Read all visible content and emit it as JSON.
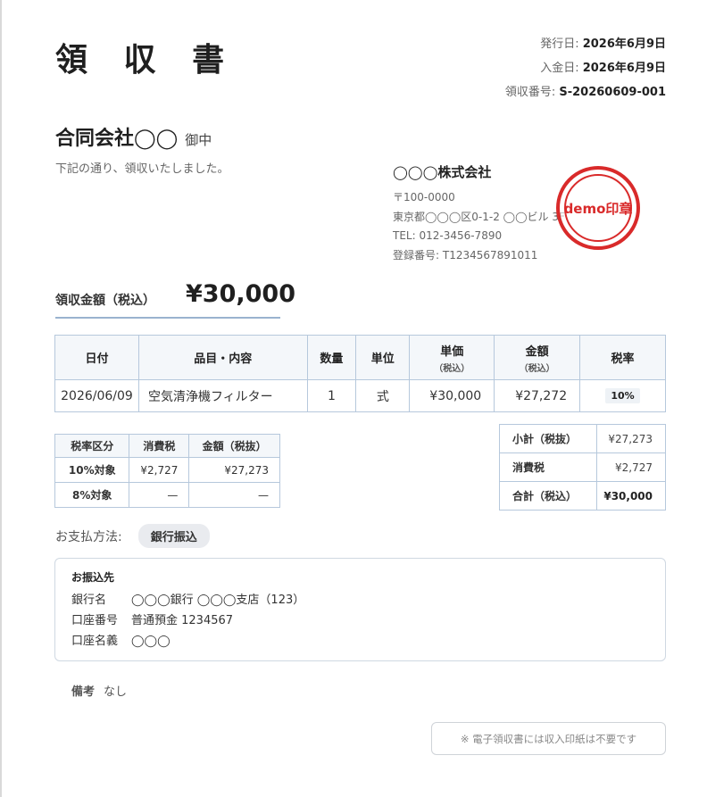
{
  "document": {
    "title": "領 収 書",
    "issue_date_label": "発行日:",
    "issue_date": "2026年6月9日",
    "payment_date_label": "入金日:",
    "payment_date": "2026年6月9日",
    "receipt_no_label": "領収番号:",
    "receipt_no": "S-20260609-001"
  },
  "recipient": {
    "name": "合同会社◯◯",
    "honorific": "御中",
    "statement": "下記の通り、領収いたしました。"
  },
  "issuer": {
    "company": "◯◯◯株式会社",
    "postal": "〒100-0000",
    "address": "東京都◯◯◯区0-1-2 ◯◯ビル 3F",
    "tel": "TEL: 012-3456-7890",
    "registration": "登録番号: T1234567891011",
    "stamp_text": "demo印章",
    "stamp_color": "#d92a2a"
  },
  "total": {
    "label": "領収金額（税込）",
    "amount": "¥30,000"
  },
  "items_table": {
    "headers": {
      "date": "日付",
      "item": "品目・内容",
      "qty": "数量",
      "unit": "単位",
      "unit_price": "単価",
      "unit_price_note": "（税込）",
      "amount": "金額",
      "amount_note": "（税込）",
      "tax_rate": "税率"
    },
    "rows": [
      {
        "date": "2026/06/09",
        "item": "空気清浄機フィルター",
        "qty": "1",
        "unit": "式",
        "unit_price": "¥30,000",
        "amount": "¥27,272",
        "tax_rate": "10%"
      }
    ]
  },
  "tax_breakdown": {
    "headers": {
      "category": "税率区分",
      "tax": "消費税",
      "amount": "金額（税抜）"
    },
    "rows": [
      {
        "category": "10%対象",
        "tax": "¥2,727",
        "amount": "¥27,273"
      },
      {
        "category": "8%対象",
        "tax": "—",
        "amount": "—"
      }
    ]
  },
  "summary": {
    "subtotal_label": "小計（税抜）",
    "subtotal": "¥27,273",
    "tax_label": "消費税",
    "tax": "¥2,727",
    "grand_label": "合計（税込）",
    "grand": "¥30,000"
  },
  "payment": {
    "label": "お支払方法:",
    "method": "銀行振込"
  },
  "bank": {
    "heading": "お振込先",
    "bank_label": "銀行名",
    "bank_value": "◯◯◯銀行 ◯◯◯支店（123）",
    "account_label": "口座番号",
    "account_value": "普通預金 1234567",
    "holder_label": "口座名義",
    "holder_value": "◯◯◯"
  },
  "note": {
    "label": "備考",
    "value": "なし"
  },
  "disclaimer": "※ 電子領収書には収入印紙は不要です"
}
